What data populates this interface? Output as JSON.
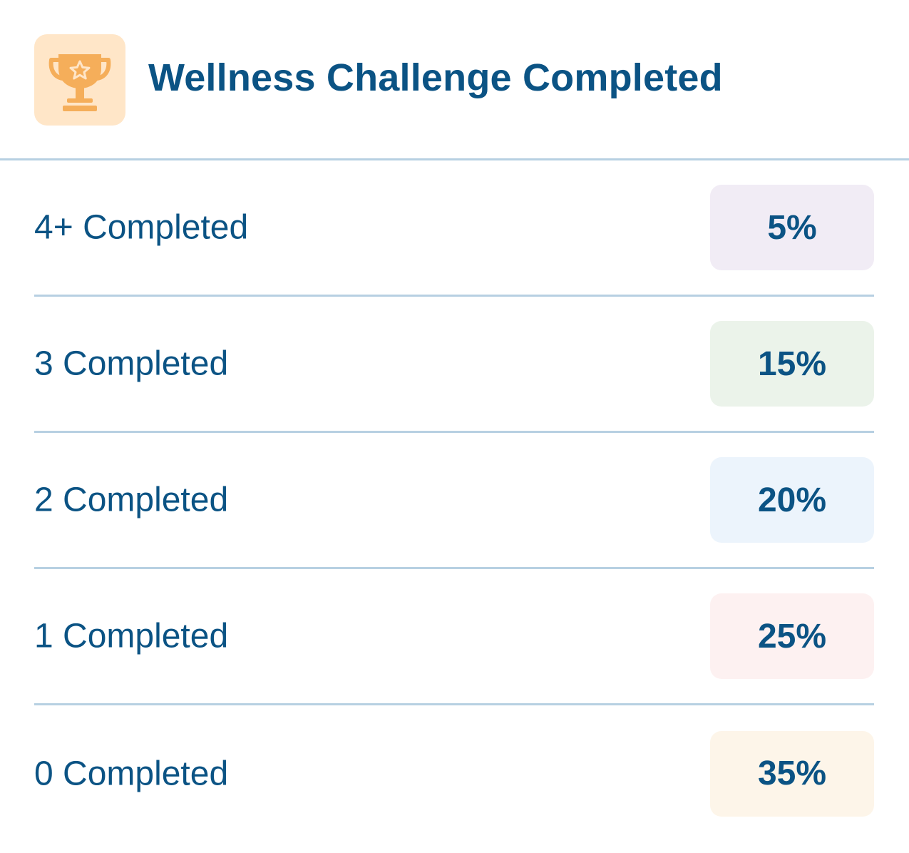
{
  "header": {
    "icon": "trophy-icon",
    "icon_color": "#f5ae5a",
    "icon_bg": "#ffe6c8",
    "title": "Wellness Challenge Completed"
  },
  "rows": [
    {
      "label": "4+ Completed",
      "value": "5%",
      "fraction": 0.05,
      "pill_color": "#f1ecf5"
    },
    {
      "label": "3 Completed",
      "value": "15%",
      "fraction": 0.15,
      "pill_color": "#ebf3ea"
    },
    {
      "label": "2 Completed",
      "value": "20%",
      "fraction": 0.2,
      "pill_color": "#ecf4fc"
    },
    {
      "label": "1 Completed",
      "value": "25%",
      "fraction": 0.25,
      "pill_color": "#fdf1f1"
    },
    {
      "label": "0 Completed",
      "value": "35%",
      "fraction": 0.35,
      "pill_color": "#fdf5e9"
    }
  ],
  "colors": {
    "text": "#0b5384",
    "divider": "#b7d0e2"
  }
}
